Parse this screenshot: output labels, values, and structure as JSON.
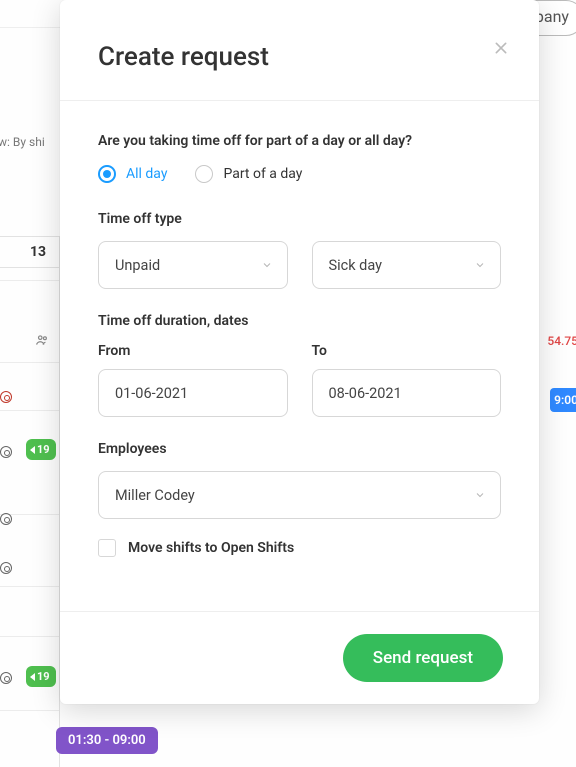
{
  "background": {
    "company_label": "Company",
    "view_label": "w: By shi",
    "day_number": "13",
    "red_hours": "54.75",
    "blue_chip": "9:00",
    "green_tab_1": "19",
    "green_tab_2": "19",
    "purple_chip": "01:30 - 09:00"
  },
  "modal": {
    "title": "Create request",
    "question": "Are you taking time off for part of a day or all day?",
    "radio": {
      "all_day": "All day",
      "part_of_day": "Part of a day"
    },
    "type_label": "Time off type",
    "type_select_1": "Unpaid",
    "type_select_2": "Sick day",
    "duration_label": "Time off duration, dates",
    "from_label": "From",
    "to_label": "To",
    "from_value": "01-06-2021",
    "to_value": "08-06-2021",
    "employees_label": "Employees",
    "employees_value": "Miller Codey",
    "move_shifts_label": "Move shifts to Open Shifts",
    "send_button": "Send request"
  }
}
